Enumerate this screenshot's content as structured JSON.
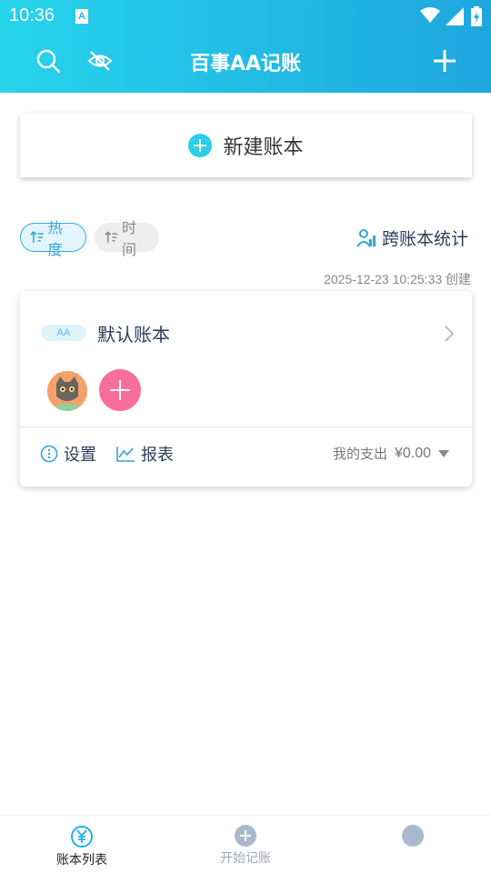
{
  "status": {
    "time": "10:36",
    "ime": "A"
  },
  "header": {
    "title": "百事AA记账",
    "icons": [
      "search-icon",
      "eye-off-icon",
      "plus-icon"
    ]
  },
  "new_book": {
    "label": "新建账本"
  },
  "sort": {
    "hot_label": "热度",
    "time_label": "时间"
  },
  "cross_stats": {
    "label": "跨账本统计"
  },
  "book": {
    "created": "2025-12-23 10:25:33 创建",
    "badge": "AA",
    "name": "默认账本",
    "settings_label": "设置",
    "report_label": "报表",
    "expense_label": "我的支出",
    "expense_amount": "¥0.00"
  },
  "tabbar": {
    "items": [
      {
        "label": "账本列表",
        "active": true
      },
      {
        "label": "开始记账",
        "active": false
      },
      {
        "label": "",
        "active": false
      }
    ]
  },
  "colors": {
    "header_start": "#27d4ec",
    "header_end": "#1ea6df",
    "accent": "#2fb1e3",
    "add_member": "#f86d9c"
  }
}
